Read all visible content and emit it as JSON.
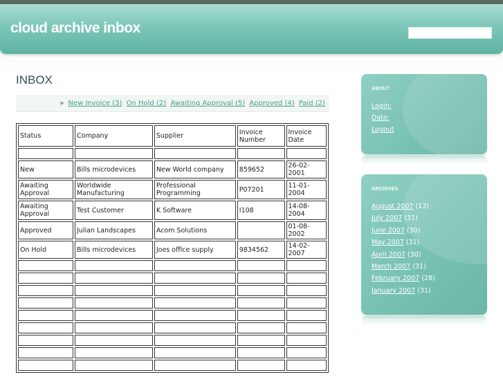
{
  "header": {
    "site_title": "cloud archive inbox",
    "search_placeholder": ""
  },
  "main": {
    "page_title": "INBOX",
    "filters": {
      "prefix": "»",
      "items": [
        {
          "label": "New Invoice (3)"
        },
        {
          "label": "On Hold (2)"
        },
        {
          "label": "Awaiting Approval (5)"
        },
        {
          "label": "Approved (4)"
        },
        {
          "label": "Paid (2)"
        }
      ]
    },
    "table": {
      "columns": [
        "Status",
        "Company",
        "Supplier",
        "Invoice Number",
        "Invoice Date"
      ],
      "rows": [
        [
          "",
          "",
          "",
          "",
          ""
        ],
        [
          "New",
          "Bills microdevices",
          "New World company",
          "859652",
          "26-02-2001"
        ],
        [
          "Awaiting Approval",
          "Worldwide Manufacturing",
          "Professional Programming",
          "P07201",
          "11-01-2004"
        ],
        [
          "Awaiting Approval",
          "Test Customer",
          "K Software",
          "I108",
          "14-08-2004"
        ],
        [
          "Approved",
          "Julian Landscapes",
          "Acom Solutions",
          "",
          "01-08-2002"
        ],
        [
          "On Hold",
          "Bills microdevices",
          "Joes office supply",
          "9834562",
          "14-02-2007"
        ],
        [
          "",
          "",
          "",
          "",
          ""
        ],
        [
          "",
          "",
          "",
          "",
          ""
        ],
        [
          "",
          "",
          "",
          "",
          ""
        ],
        [
          "",
          "",
          "",
          "",
          ""
        ],
        [
          "",
          "",
          "",
          "",
          ""
        ],
        [
          "",
          "",
          "",
          "",
          ""
        ],
        [
          "",
          "",
          "",
          "",
          ""
        ],
        [
          "",
          "",
          "",
          "",
          ""
        ],
        [
          "",
          "",
          "",
          "",
          ""
        ]
      ]
    }
  },
  "sidebar": {
    "about": {
      "heading": "ABOUT",
      "links": [
        {
          "label": "Login:"
        },
        {
          "label": "Date:"
        },
        {
          "label": "Logout"
        }
      ]
    },
    "archives": {
      "heading": "ARCHIVES",
      "items": [
        {
          "label": "August 2007",
          "count": "(13)"
        },
        {
          "label": "July 2007",
          "count": "(31)"
        },
        {
          "label": "June 2007",
          "count": "(30)"
        },
        {
          "label": "May 2007",
          "count": "(31)"
        },
        {
          "label": "April 2007",
          "count": "(30)"
        },
        {
          "label": "March 2007",
          "count": "(31)"
        },
        {
          "label": "February 2007",
          "count": "(28)"
        },
        {
          "label": "January 2007",
          "count": "(31)"
        }
      ]
    }
  },
  "colors": {
    "accent": "#7cc7b8",
    "link": "#4a9d8e",
    "topbar": "#5a6a5e"
  }
}
